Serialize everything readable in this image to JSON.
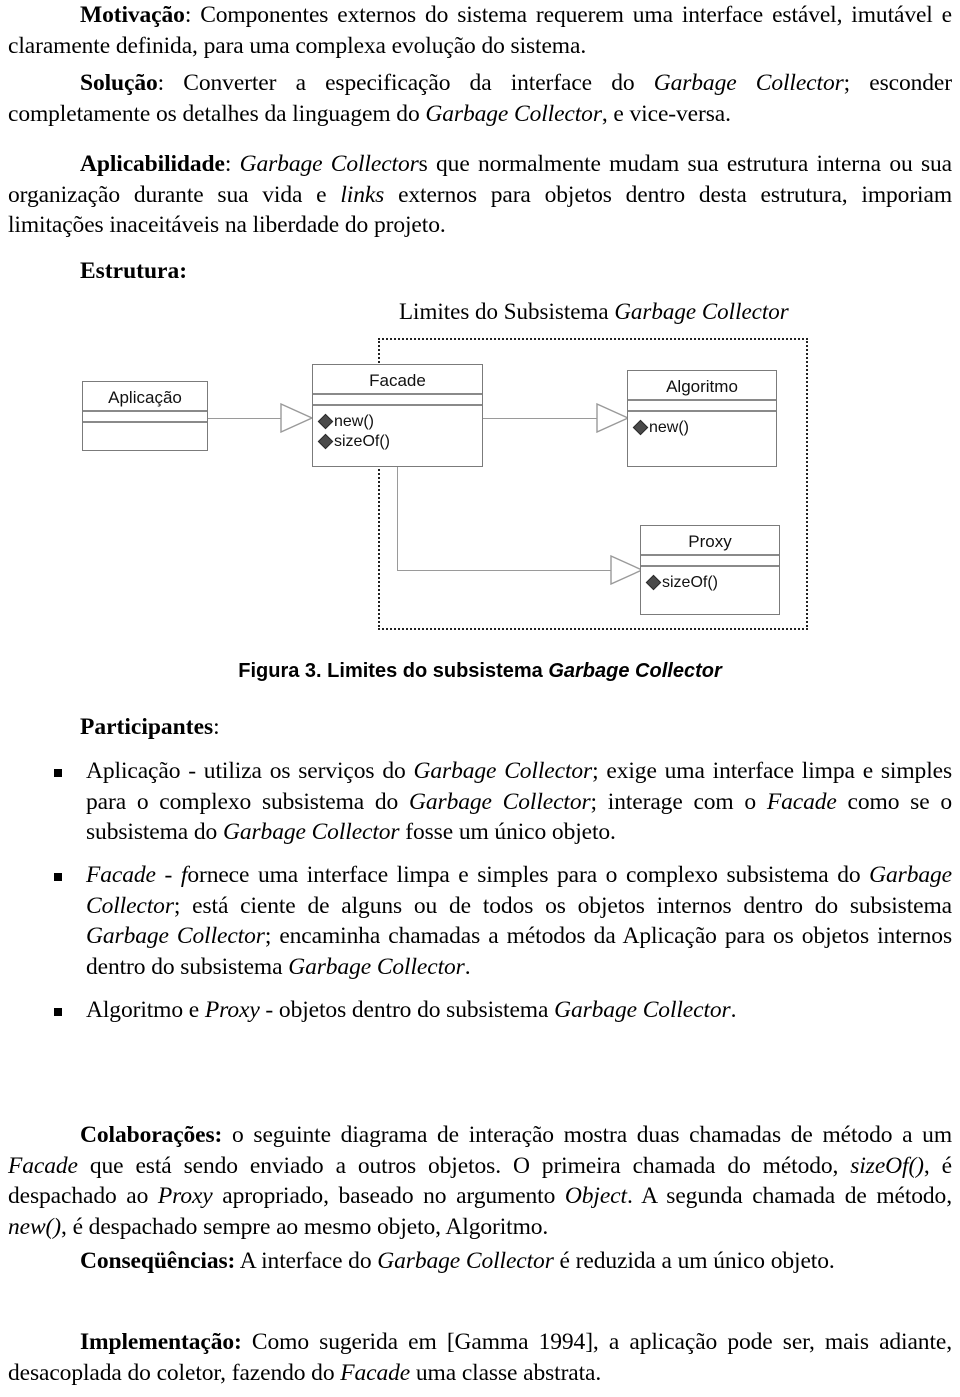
{
  "document": {
    "language": "pt-BR",
    "sections": [
      {
        "id": "motivacao",
        "lead": "Motivação",
        "separator": ": ",
        "text": "Componentes externos do sistema requerem uma interface estável, imutável e claramente definida, para uma complexa evolução do sistema."
      },
      {
        "id": "solucao",
        "lead": "Solução",
        "separator": ": ",
        "text": "Converter a especificação da interface do Garbage Collector; esconder completamente os detalhes da linguagem do Garbage Collector, e vice-versa."
      },
      {
        "id": "aplicabilidade",
        "lead": "Aplicabilidade",
        "separator": ": ",
        "text": "Garbage Collectors que normalmente mudam sua estrutura interna ou sua organização durante sua vida e links externos para objetos dentro desta estrutura, imporiam limitações inaceitáveis na liberdade do projeto."
      }
    ],
    "estrutura_label": "Estrutura:",
    "figure": {
      "boundary_title": "Limites do Subsistema Garbage Collector",
      "boundary_title_plain": "Limites do Subsistema ",
      "boundary_title_italic": "Garbage Collector",
      "caption_number": "Figura 3.",
      "caption_text": " Limites do subsistema ",
      "caption_italic": "Garbage Collector",
      "classes": [
        {
          "id": "aplicacao",
          "name": "Aplicação",
          "operations": [],
          "inside_subsystem": false
        },
        {
          "id": "facade",
          "name": "Facade",
          "operations": [
            "new()",
            "sizeOf()"
          ],
          "inside_subsystem": true
        },
        {
          "id": "algoritmo",
          "name": "Algoritmo",
          "operations": [
            "new()"
          ],
          "inside_subsystem": true
        },
        {
          "id": "proxy",
          "name": "Proxy",
          "operations": [
            "sizeOf()"
          ],
          "inside_subsystem": true
        }
      ],
      "connections": [
        {
          "from": "aplicacao",
          "to": "facade",
          "style": "hollow-triangle"
        },
        {
          "from": "facade",
          "to": "algoritmo",
          "style": "hollow-triangle"
        },
        {
          "from": "facade",
          "to": "proxy",
          "style": "hollow-triangle"
        }
      ],
      "colors": {
        "class_border": "#7b7b7b",
        "class_divider": "#8a8a8a",
        "connector": "#9a9a9a",
        "boundary": "#222222",
        "op_marker": "#4a4a4a"
      }
    },
    "participantes_label": "Participantes",
    "participantes_separator": ":",
    "participantes": [
      {
        "id": "participante-aplicacao",
        "text": "Aplicação - utiliza os serviços do Garbage Collector; exige uma interface limpa e simples para o complexo subsistema do Garbage Collector; interage com o Facade como se o subsistema do Garbage Collector fosse um único objeto."
      },
      {
        "id": "participante-facade",
        "text": "Facade - fornece uma interface limpa e simples para o complexo subsistema do Garbage Collector; está ciente de alguns ou de todos os objetos internos dentro do subsistema Garbage Collector; encaminha chamadas a métodos da Aplicação para os objetos internos dentro do subsistema Garbage Collector."
      },
      {
        "id": "participante-algoritmo-proxy",
        "text": "Algoritmo e Proxy - objetos dentro do subsistema Garbage Collector."
      }
    ],
    "tail_sections": [
      {
        "id": "colaboracoes",
        "lead": "Colaborações:",
        "text": " o seguinte diagrama de interação mostra duas chamadas de método a um Facade que está sendo enviado a outros objetos. O primeira chamada do método, sizeOf(), é despachado ao Proxy apropriado, baseado no argumento Object. A segunda chamada de método, new(), é despachado sempre ao mesmo objeto, Algoritmo."
      },
      {
        "id": "consequencias",
        "lead": "Conseqüências:",
        "text": " A interface do Garbage Collector é reduzida a um único objeto."
      },
      {
        "id": "implementacao",
        "lead": "Implementação:",
        "text": " Como sugerida em [Gamma 1994], a aplicação pode ser, mais adiante, desacoplada do coletor, fazendo do Facade uma classe abstrata."
      }
    ]
  }
}
